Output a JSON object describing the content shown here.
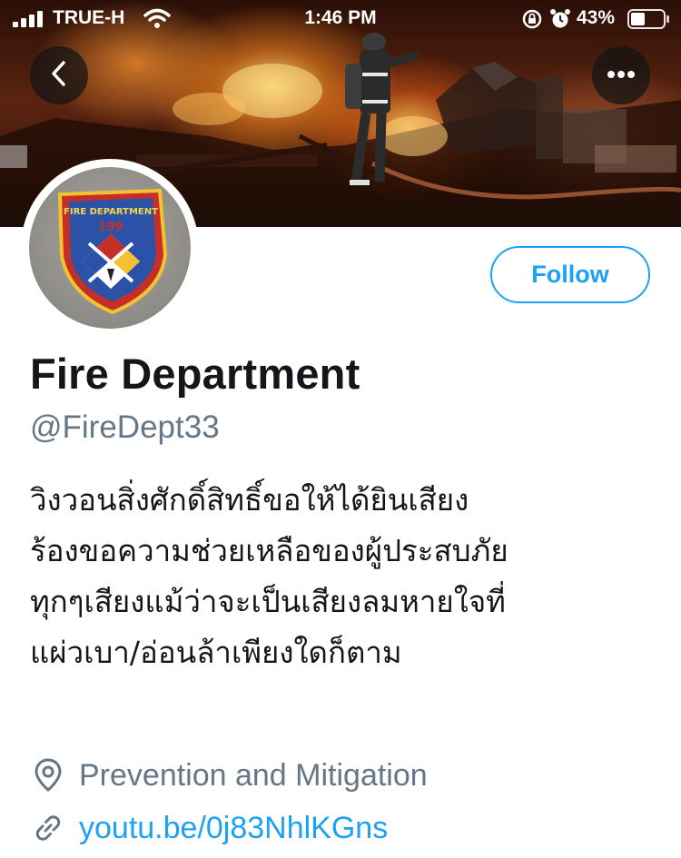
{
  "status_bar": {
    "carrier": "TRUE-H",
    "time": "1:46 PM",
    "battery_percent": "43%"
  },
  "navigation": {
    "back_icon": "chevron-left-icon",
    "more_icon": "ellipsis-icon"
  },
  "profile": {
    "name": "Fire Department",
    "handle": "@FireDept33",
    "follow_label": "Follow",
    "bio_lines": [
      "วิงวอนสิ่งศักดิ์สิทธิ์ขอให้ได้ยินเสียง",
      "ร้องขอความช่วยเหลือของผู้ประสบภัย",
      "ทุกๆเสียงแม้ว่าจะเป็นเสียงลมหายใจที่",
      "แผ่วเบา/อ่อนล้าเพียงใดก็ตาม"
    ],
    "location": "Prevention and Mitigation",
    "website": "youtu.be/0j83NhlKGns"
  },
  "avatar": {
    "patch_text": "FIRE DEPARTMENT",
    "patch_number": "199"
  },
  "colors": {
    "accent": "#1da1f2",
    "secondary_text": "#657786",
    "primary_text": "#14171a"
  }
}
